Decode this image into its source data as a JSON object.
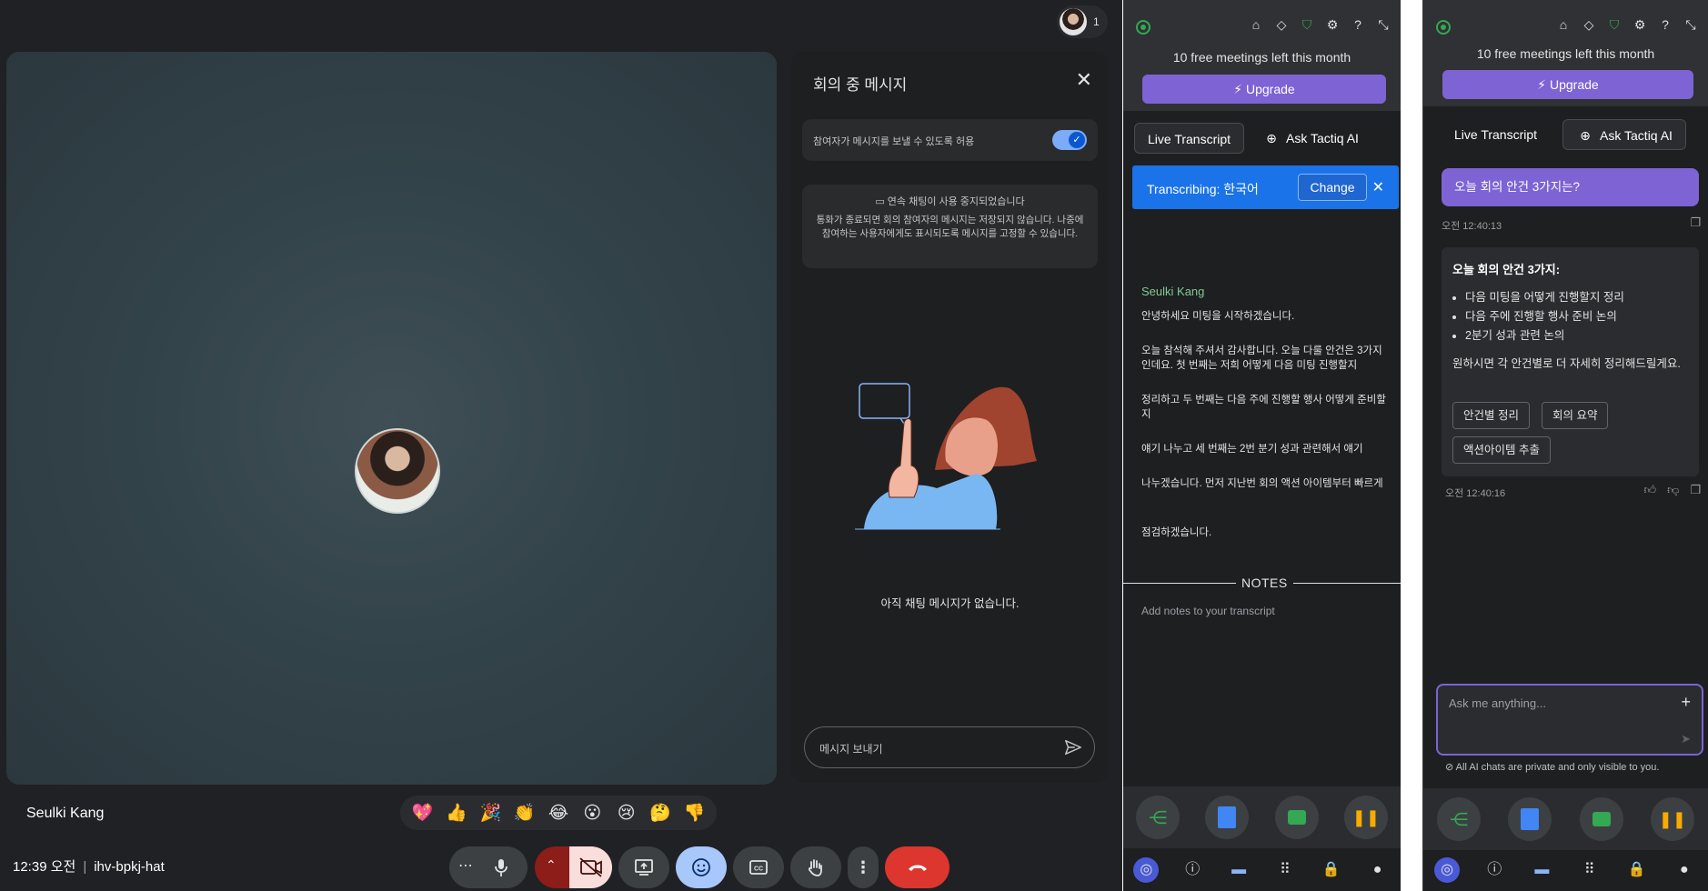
{
  "meet": {
    "participant_name": "Seulki Kang",
    "people_count": "1",
    "meeting_time": "12:39 오전",
    "meeting_code": "ihv-bpkj-hat",
    "chat": {
      "title": "회의 중 메시지",
      "allow_label": "참여자가 메시지를 보낼 수 있도록 허용",
      "allow_enabled": true,
      "info_title": "연속 채팅이 사용 중지되었습니다",
      "info_body": "통화가 종료되면 회의 참여자의 메시지는 저장되지 않습니다. 나중에 참여하는 사용자에게도 표시되도록 메시지를 고정할 수 있습니다.",
      "empty_text": "아직 채팅 메시지가 없습니다.",
      "input_placeholder": "메시지 보내기"
    },
    "reactions": [
      "💖",
      "👍",
      "🎉",
      "👏",
      "😂",
      "😮",
      "😢",
      "🤔",
      "👎"
    ],
    "controls": [
      "more-audio",
      "mic",
      "camera-off",
      "present",
      "reactions",
      "captions",
      "raise-hand",
      "more-options",
      "end-call"
    ]
  },
  "tactiq": {
    "free_meetings": "10 free meetings left this month",
    "upgrade_label": "⚡ Upgrade",
    "tab_transcript": "Live Transcript",
    "tab_ask": "Ask Tactiq AI",
    "transcribing_label": "Transcribing: 한국어",
    "change_label": "Change",
    "speaker": "Seulki Kang",
    "transcript": [
      "안녕하세요 미팅을 시작하겠습니다.",
      "오늘 참석해 주셔서 감사합니다. 오늘 다룰 안건은 3가지인데요. 첫 번째는 저희 어떻게 다음 미팅 진행할지",
      "정리하고 두 번째는 다음 주에 진행할 행사 어떻게 준비할지",
      "얘기 나누고 세 번째는 2번 분기 성과 관련해서 얘기",
      "나누겠습니다. 먼저 지난번 회의 액션 아이템부터 빠르게",
      "점검하겠습니다."
    ],
    "notes_label": "NOTES",
    "notes_placeholder": "Add notes to your transcript",
    "ai": {
      "question": "오늘 회의 안건 3가지는?",
      "question_time": "오전 12:40:13",
      "answer_heading": "오늘 회의 안건 3가지:",
      "answer_items": [
        "다음 미팅을 어떻게 진행할지 정리",
        "다음 주에 진행할 행사 준비 논의",
        "2분기 성과 관련 논의"
      ],
      "answer_followup": "원하시면 각 안건별로 더 자세히 정리해드릴게요.",
      "chips": [
        "안건별 정리",
        "회의 요약",
        "액션아이템 추출"
      ],
      "answer_time": "오전 12:40:16",
      "input_placeholder": "Ask me anything...",
      "private_note": "All AI chats are private and only visible to you."
    },
    "colors": {
      "accent": "#7d63d4",
      "blue": "#1a73e8",
      "speaker": "#81c995"
    }
  }
}
